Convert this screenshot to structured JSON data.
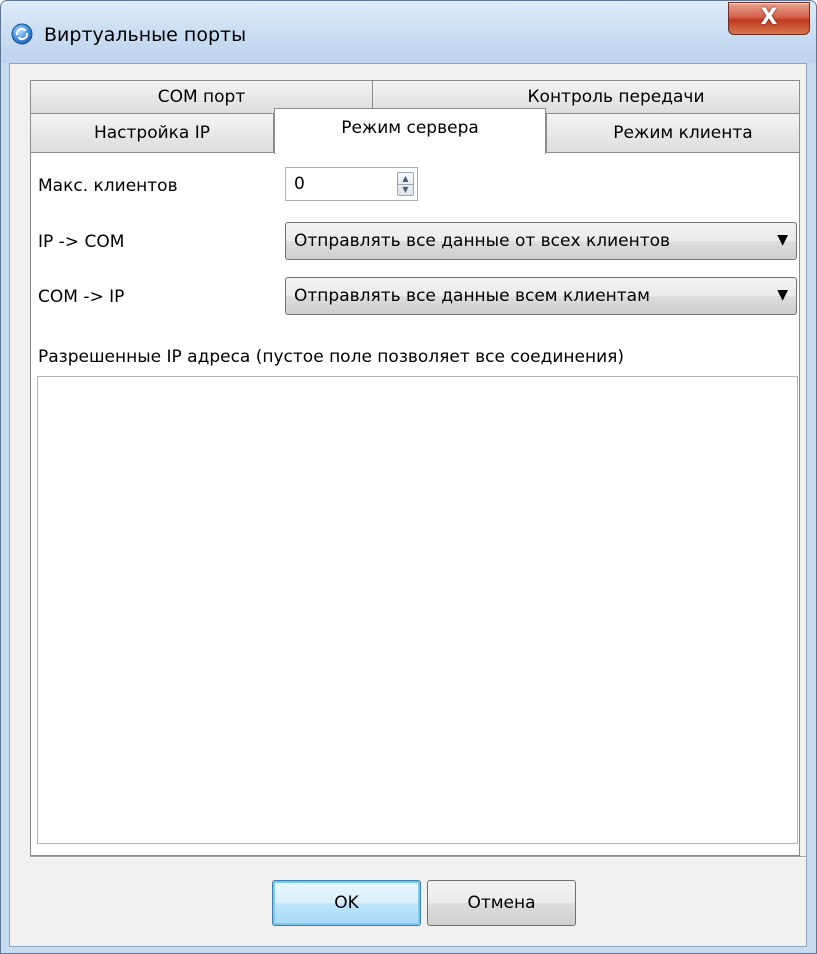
{
  "window": {
    "title": "Виртуальные порты",
    "close_glyph": "X"
  },
  "tabs": [
    {
      "label": "COM порт",
      "active": false
    },
    {
      "label": "Контроль передачи",
      "active": false
    },
    {
      "label": "Настройка IP",
      "active": false
    },
    {
      "label": "Режим сервера",
      "active": true
    },
    {
      "label": "Режим клиента",
      "active": false
    }
  ],
  "server": {
    "max_clients_label": "Макс. клиентов",
    "max_clients_value": "0",
    "ip_to_com_label": "IP -> COM",
    "ip_to_com_value": "Отправлять все данные от всех клиентов",
    "com_to_ip_label": "COM -> IP",
    "com_to_ip_value": "Отправлять все данные всем клиентам",
    "allowed_ip_label": "Разрешенные IP адреса (пустое поле позволяет все соединения)",
    "allowed_ip_value": ""
  },
  "buttons": {
    "ok_label": "OK",
    "cancel_label": "Отмена"
  },
  "colors": {
    "title_bar": "#c9dcf2",
    "close_button": "#c0391e",
    "default_button": "#bee6fd",
    "dialog_background": "#f0f0f0"
  },
  "icons": {
    "app": "globe-arrows-icon",
    "close": "close-icon",
    "spin_up": "spin-up-icon",
    "spin_down": "spin-down-icon",
    "dropdown": "chevron-down-icon"
  }
}
